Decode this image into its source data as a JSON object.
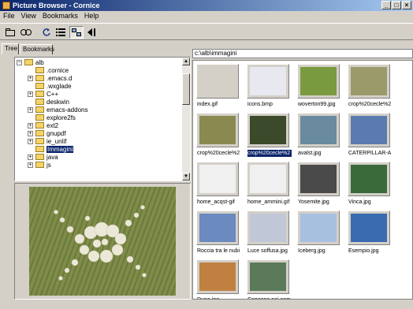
{
  "window": {
    "title": "Picture Browser - Cornice"
  },
  "menu": [
    "File",
    "View",
    "Bookmarks",
    "Help"
  ],
  "toolbar": {
    "icons": [
      "open-folder-icon",
      "slideshow-icon",
      "refresh-icon",
      "list-view-icon",
      "thumbnail-view-icon",
      "back-icon"
    ]
  },
  "tabs": [
    {
      "label": "Tree"
    },
    {
      "label": "Bookmarks"
    }
  ],
  "tree": {
    "items": [
      {
        "label": "alb"
      },
      {
        "label": ".cornice"
      },
      {
        "label": ".emacs.d"
      },
      {
        "label": ".wxglade"
      },
      {
        "label": "C++"
      },
      {
        "label": "deskwin"
      },
      {
        "label": "emacs-addons"
      },
      {
        "label": "explore2fs"
      },
      {
        "label": "ext2"
      },
      {
        "label": "gnupdf"
      },
      {
        "label": "ie_unlif"
      },
      {
        "label": "Immagini"
      },
      {
        "label": "java"
      },
      {
        "label": "js"
      }
    ]
  },
  "path": {
    "value": "c:\\alb\\immagini"
  },
  "thumbnails": [
    {
      "label": "index.gif"
    },
    {
      "label": "icons.bmp"
    },
    {
      "label": "woverton99.jpg"
    },
    {
      "label": "crop%20cecle%2"
    },
    {
      "label": "crop%20cecle%2"
    },
    {
      "label": "crop%20cecle%2"
    },
    {
      "label": "avalst.jpg"
    },
    {
      "label": "CATERPILLAR-A"
    },
    {
      "label": "home_acqst-gif"
    },
    {
      "label": "home_ammini.gif"
    },
    {
      "label": "Yosemite.jpg"
    },
    {
      "label": "Vinca.jpg"
    },
    {
      "label": "Roccia tra le nubi"
    },
    {
      "label": "Luce soffusa.jpg"
    },
    {
      "label": "Iceberg.jpg"
    },
    {
      "label": "Esempio.jpg"
    },
    {
      "label": "Dune.jpg"
    },
    {
      "label": "Capanno nei cam"
    }
  ],
  "selected_thumbnail": "crop%20cecle%2",
  "colors": {
    "titlebar": "#0a246a",
    "selection": "#0a246a",
    "window": "#d4d0c8"
  }
}
